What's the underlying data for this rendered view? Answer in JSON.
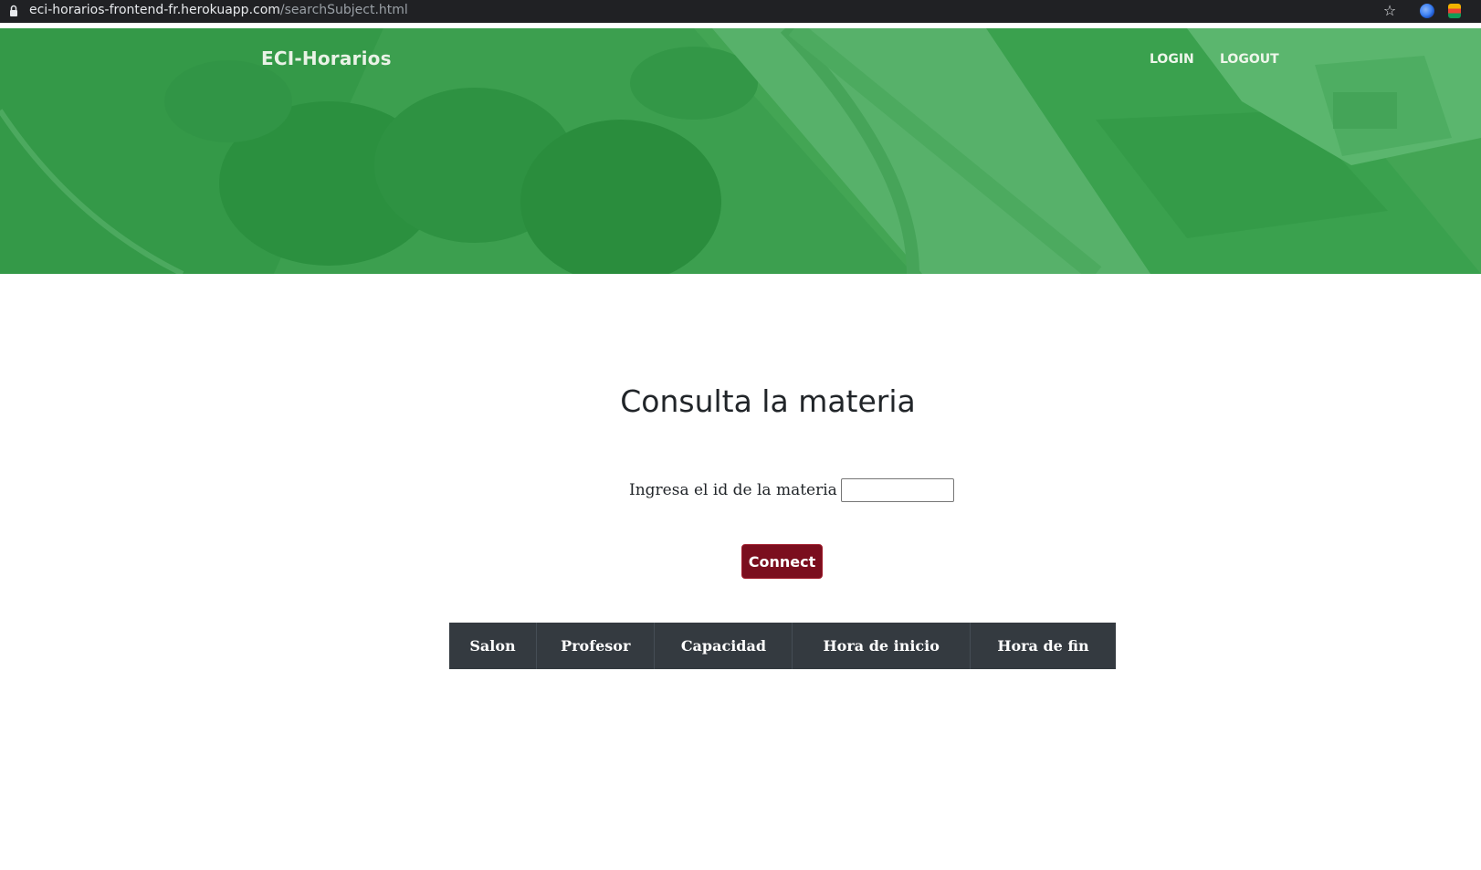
{
  "browser": {
    "url_host": "eci-horarios-frontend-fr.herokuapp.com",
    "url_path": "/searchSubject.html"
  },
  "header": {
    "brand": "ECI-Horarios",
    "nav": {
      "login": "LOGIN",
      "logout": "LOGOUT"
    }
  },
  "main": {
    "title": "Consulta la materia",
    "input_label": "Ingresa el id de la materia",
    "input_value": "",
    "connect_label": "Connect",
    "table": {
      "columns": [
        "Salon",
        "Profesor",
        "Capacidad",
        "Hora de inicio",
        "Hora de fin"
      ]
    }
  },
  "colors": {
    "hero_green": "#4fa45e",
    "button_bg": "#7b0e1e",
    "table_header_bg": "#343a40"
  },
  "icons": {
    "lock": "lock-icon",
    "star": "star-icon",
    "extension_1": "browser-extension-icon",
    "extension_2": "browser-extension-icon"
  }
}
